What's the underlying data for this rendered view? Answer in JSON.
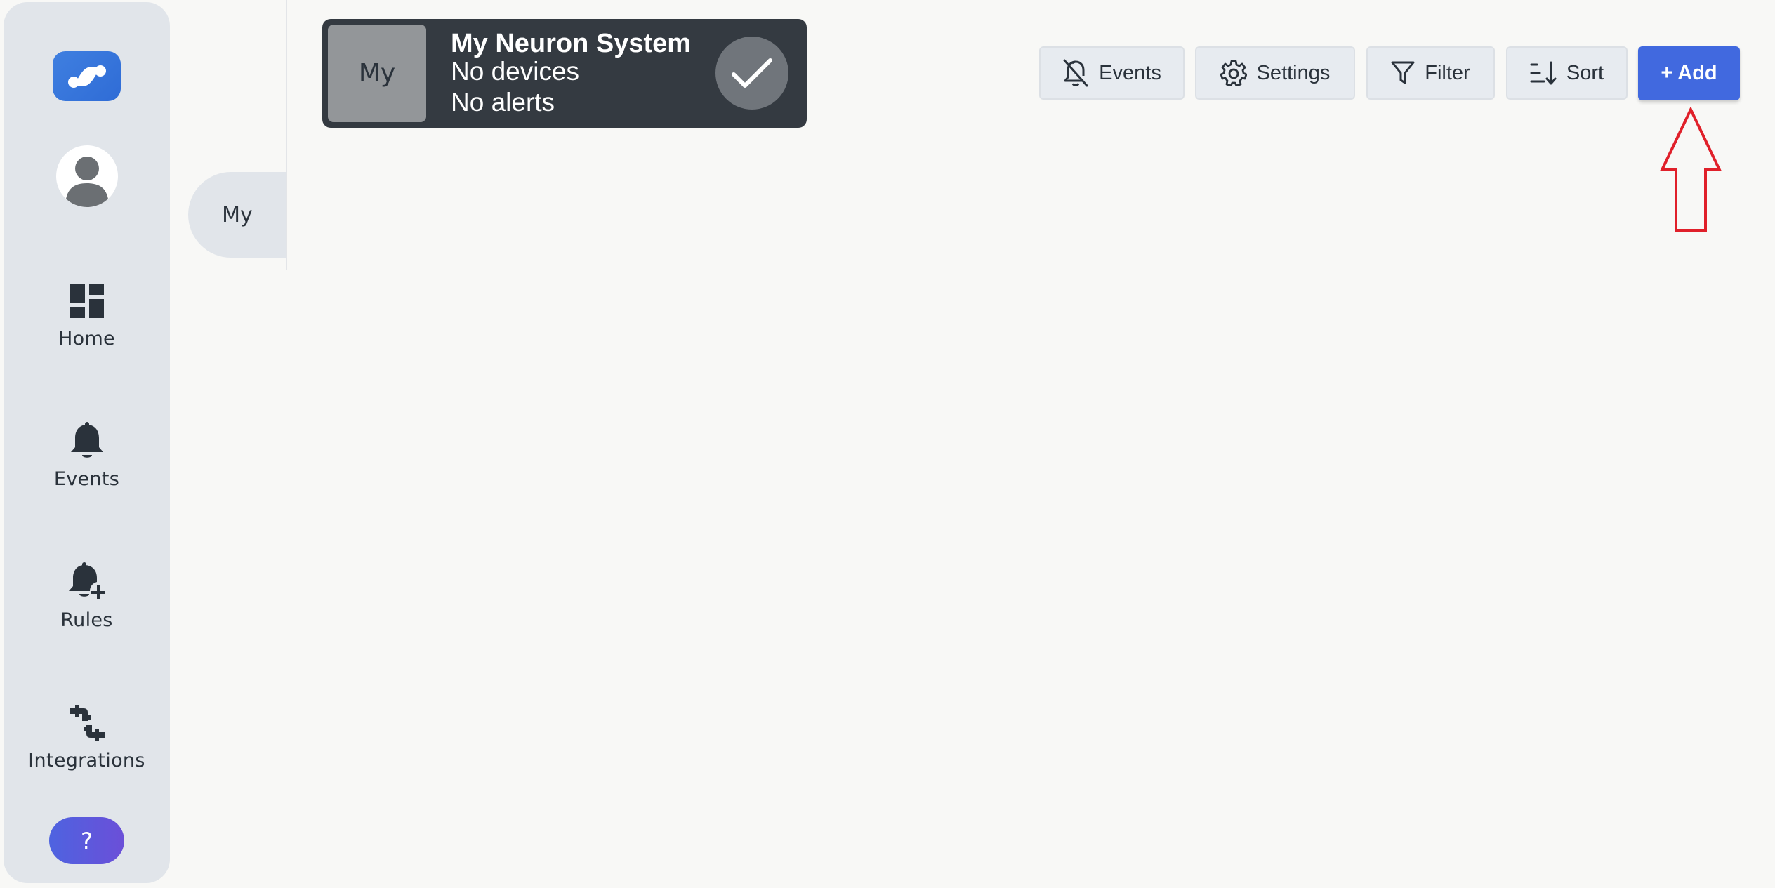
{
  "sidebar": {
    "items": [
      {
        "label": "Home",
        "icon": "dashboard-icon"
      },
      {
        "label": "Events",
        "icon": "bell-icon"
      },
      {
        "label": "Rules",
        "icon": "bell-plus-icon"
      },
      {
        "label": "Integrations",
        "icon": "integrations-icon"
      }
    ],
    "help_label": "?"
  },
  "rail": {
    "tab_label": "My"
  },
  "system_card": {
    "thumb_label": "My",
    "title": "My Neuron System",
    "devices": "No devices",
    "alerts": "No alerts"
  },
  "toolbar": {
    "events_label": "Events",
    "settings_label": "Settings",
    "filter_label": "Filter",
    "sort_label": "Sort",
    "add_label": "+ Add"
  },
  "colors": {
    "accent": "#4169df",
    "sidebar_bg": "#e1e5ea",
    "card_bg": "#343a41",
    "annotation": "#e0202a"
  }
}
